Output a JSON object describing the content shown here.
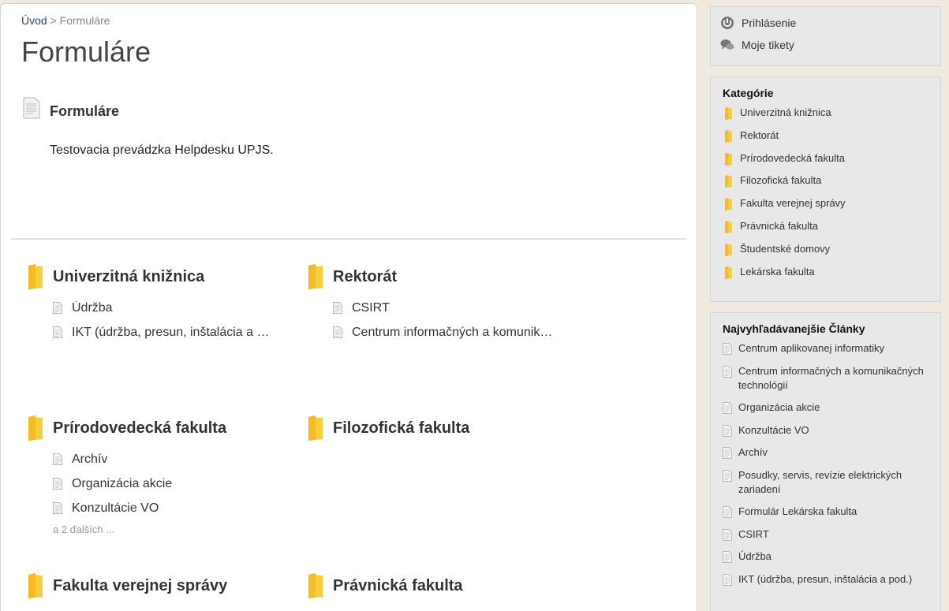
{
  "breadcrumb": {
    "home": "Úvod",
    "separator": ">",
    "current": "Formuláre"
  },
  "page_title": "Formuláre",
  "intro": {
    "title": "Formuláre",
    "text": "Testovacia prevádzka Helpdesku UPJS."
  },
  "categories": [
    {
      "title": "Univerzitná knižnica",
      "items": [
        "Údržba",
        "IKT (údržba, presun, inštalácia a …"
      ],
      "more": ""
    },
    {
      "title": "Rektorát",
      "items": [
        "CSIRT",
        "Centrum informačných a komunik…"
      ],
      "more": ""
    },
    {
      "title": "Prírodovedecká fakulta",
      "items": [
        "Archív",
        "Organizácia akcie",
        "Konzultácie VO"
      ],
      "more": "a 2 ďalších ..."
    },
    {
      "title": "Filozofická fakulta",
      "items": [],
      "more": ""
    },
    {
      "title": "Fakulta verejnej správy",
      "items": [],
      "more": ""
    },
    {
      "title": "Právnická fakulta",
      "items": [],
      "more": ""
    }
  ],
  "sidebar": {
    "login": "Prihlásenie",
    "tickets": "Moje tikety",
    "categories_title": "Kategórie",
    "categories": [
      "Univerzitná knižnica",
      "Rektorát",
      "Prírodovedecká fakulta",
      "Filozofická fakulta",
      "Fakulta verejnej správy",
      "Právnická fakulta",
      "Študentské domovy",
      "Lekárska fakulta"
    ],
    "popular_title": "Najvyhľadávanejšie Články",
    "popular": [
      "Centrum aplikovanej informatiky",
      "Centrum informačných a komunikačných technológií",
      "Organizácia akcie",
      "Konzultácie VO",
      "Archív",
      "Posudky, servis, revízie elektrických zariadení",
      "Formulár Lekárska fakulta",
      "CSIRT",
      "Údržba",
      "IKT (údržba, presun, inštalácia a pod.)"
    ]
  },
  "colors": {
    "folder": "#f5c518",
    "link": "#2a4a6a",
    "sidebar_bg": "#e8e8e8",
    "page_bg": "#efe9e0"
  }
}
